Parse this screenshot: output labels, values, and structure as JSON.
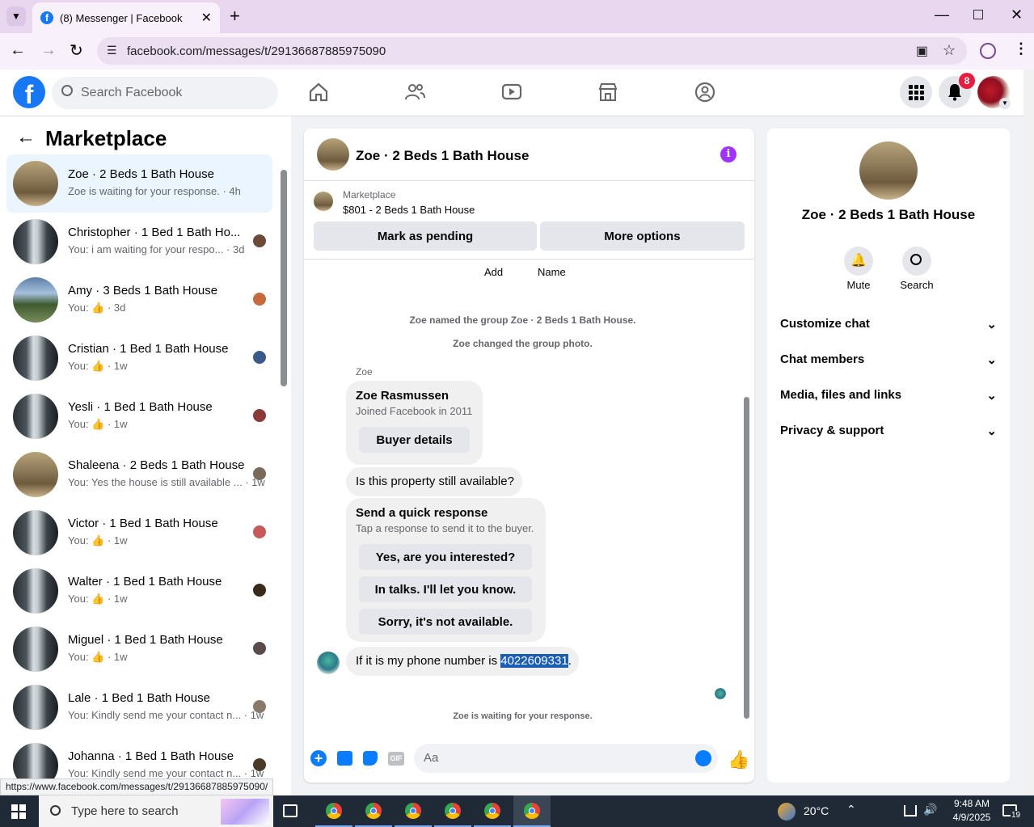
{
  "browser": {
    "tab_title": "(8) Messenger | Facebook",
    "url": "facebook.com/messages/t/29136687885975090",
    "status_url": "https://www.facebook.com/messages/t/29136687885975090/"
  },
  "fb_header": {
    "search_placeholder": "Search Facebook",
    "notification_count": "8"
  },
  "sidebar": {
    "title": "Marketplace",
    "conversations": [
      {
        "title": "Zoe · 2 Beds 1 Bath House",
        "preview": "Zoe is waiting for your response. · 4h",
        "thumb": "house"
      },
      {
        "title": "Christopher · 1 Bed 1 Bath Ho...",
        "preview": "You: i am waiting for your respo... · 3d",
        "thumb": "door"
      },
      {
        "title": "Amy · 3 Beds 1 Bath House",
        "preview": "You: 👍 · 3d",
        "thumb": "yard"
      },
      {
        "title": "Cristian · 1 Bed 1 Bath House",
        "preview": "You: 👍 · 1w",
        "thumb": "door"
      },
      {
        "title": "Yesli · 1 Bed 1 Bath House",
        "preview": "You: 👍 · 1w",
        "thumb": "door"
      },
      {
        "title": "Shaleena · 2 Beds 1 Bath House",
        "preview": "You: Yes the house is still available ... · 1w",
        "thumb": "house"
      },
      {
        "title": "Victor · 1 Bed 1 Bath House",
        "preview": "You: 👍 · 1w",
        "thumb": "door"
      },
      {
        "title": "Walter · 1 Bed 1 Bath House",
        "preview": "You: 👍 · 1w",
        "thumb": "door"
      },
      {
        "title": "Miguel · 1 Bed 1 Bath House",
        "preview": "You: 👍 · 1w",
        "thumb": "door"
      },
      {
        "title": "Lale · 1 Bed 1 Bath House",
        "preview": "You: Kindly send me your contact n... · 1w",
        "thumb": "door"
      },
      {
        "title": "Johanna · 1 Bed 1 Bath House",
        "preview": "You: Kindly send me your contact n... · 1w",
        "thumb": "door"
      }
    ]
  },
  "chat": {
    "title": "Zoe · 2 Beds 1 Bath House",
    "listing_source": "Marketplace",
    "listing": "$801 - 2 Beds 1 Bath House",
    "mark_pending": "Mark as pending",
    "more_options": "More options",
    "add_label": "Add",
    "name_label": "Name",
    "system_1": "Zoe named the group Zoe · 2 Beds 1 Bath House.",
    "system_2": "Zoe changed the group photo.",
    "sender": "Zoe",
    "profile_name": "Zoe Rasmussen",
    "profile_joined": "Joined Facebook in 2011",
    "buyer_details": "Buyer details",
    "question": "Is this property still available?",
    "quick_title": "Send a quick response",
    "quick_sub": "Tap a response to send it to the buyer.",
    "quick_1": "Yes, are you interested?",
    "quick_2": "In talks. I'll let you know.",
    "quick_3": "Sorry, it's not available.",
    "last_msg_prefix": "If it is my phone number is ",
    "last_msg_number": "4022609331",
    "last_msg_suffix": ".",
    "waiting": "Zoe is waiting for your response.",
    "composer_placeholder": "Aa"
  },
  "info_panel": {
    "title": "Zoe · 2 Beds 1 Bath House",
    "mute": "Mute",
    "search": "Search",
    "sections": [
      "Customize chat",
      "Chat members",
      "Media, files and links",
      "Privacy & support"
    ]
  },
  "taskbar": {
    "search_placeholder": "Type here to search",
    "temperature": "20°C",
    "time": "9:48 AM",
    "date": "4/9/2025",
    "notif_count": "19"
  },
  "colors": {
    "fb_blue": "#1877f2",
    "messenger_purple": "#a033ff",
    "notif_red": "#e41e3f",
    "selected_conv": "#ebf5ff"
  }
}
